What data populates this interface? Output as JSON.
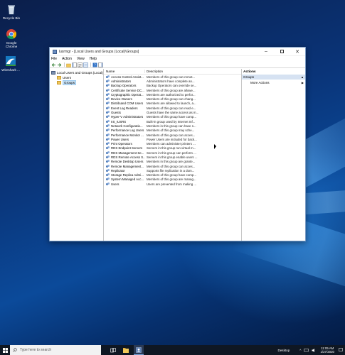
{
  "desktop": {
    "icons": [
      {
        "label": "Recycle Bin",
        "icon": "recycle-bin-icon"
      },
      {
        "label": "Google Chrome",
        "icon": "chrome-icon"
      },
      {
        "label": "Wireshark ...",
        "icon": "wireshark-icon"
      }
    ]
  },
  "window": {
    "title": "lusrmgr - [Local Users and Groups (Local)\\Groups]",
    "menu": [
      "File",
      "Action",
      "View",
      "Help"
    ],
    "tree": {
      "root": "Local Users and Groups (Local)",
      "children": [
        "Users",
        "Groups"
      ],
      "selected": "Groups"
    },
    "list": {
      "columns": [
        "Name",
        "Description"
      ],
      "rows": [
        {
          "name": "Access Control Assist...",
          "description": "Members of this group can remot..."
        },
        {
          "name": "Administrators",
          "description": "Administrators have complete an..."
        },
        {
          "name": "Backup Operators",
          "description": "Backup Operators can override se..."
        },
        {
          "name": "Certificate Service DC...",
          "description": "Members of this group are allowe..."
        },
        {
          "name": "Cryptographic Operat...",
          "description": "Members are authorized to perfor..."
        },
        {
          "name": "Device Owners",
          "description": "Members of this group can chang..."
        },
        {
          "name": "Distributed COM Users",
          "description": "Members are allowed to launch, a..."
        },
        {
          "name": "Event Log Readers",
          "description": "Members of this group can read e..."
        },
        {
          "name": "Guests",
          "description": "Guests have the same access as m..."
        },
        {
          "name": "Hyper-V Administrators",
          "description": "Members of this group have comp..."
        },
        {
          "name": "IIS_IUSRS",
          "description": "Built-in group used by Internet Inf..."
        },
        {
          "name": "Network Configuratio...",
          "description": "Members in this group can have s..."
        },
        {
          "name": "Performance Log Users",
          "description": "Members of this group may sche..."
        },
        {
          "name": "Performance Monitor ...",
          "description": "Members of this group can acces..."
        },
        {
          "name": "Power Users",
          "description": "Power Users are included for back..."
        },
        {
          "name": "Print Operators",
          "description": "Members can administer printers ..."
        },
        {
          "name": "RDS Endpoint Servers",
          "description": "Servers in this group run virtual m..."
        },
        {
          "name": "RDS Management Se...",
          "description": "Servers in this group can perform ..."
        },
        {
          "name": "RDS Remote Access S...",
          "description": "Servers in this group enable users ..."
        },
        {
          "name": "Remote Desktop Users",
          "description": "Members in this group are grante..."
        },
        {
          "name": "Remote Management...",
          "description": "Members of this group can acces..."
        },
        {
          "name": "Replicator",
          "description": "Supports file replication in a dom..."
        },
        {
          "name": "Storage Replica Admi...",
          "description": "Members of this group have comp..."
        },
        {
          "name": "System Managed Acc...",
          "description": "Members of this group are manag..."
        },
        {
          "name": "Users",
          "description": "Users are prevented from making ..."
        }
      ]
    },
    "actions": {
      "title": "Actions",
      "section": "Groups",
      "items": [
        "More Actions"
      ]
    }
  },
  "taskbar": {
    "search_placeholder": "Type here to search",
    "desktop_label": "Desktop",
    "time": "11:05 AM",
    "date": "1/27/2020"
  },
  "colors": {
    "selection": "#cce4f7",
    "actions_section": "#d6e2f2",
    "taskbar": "#0f1723"
  }
}
